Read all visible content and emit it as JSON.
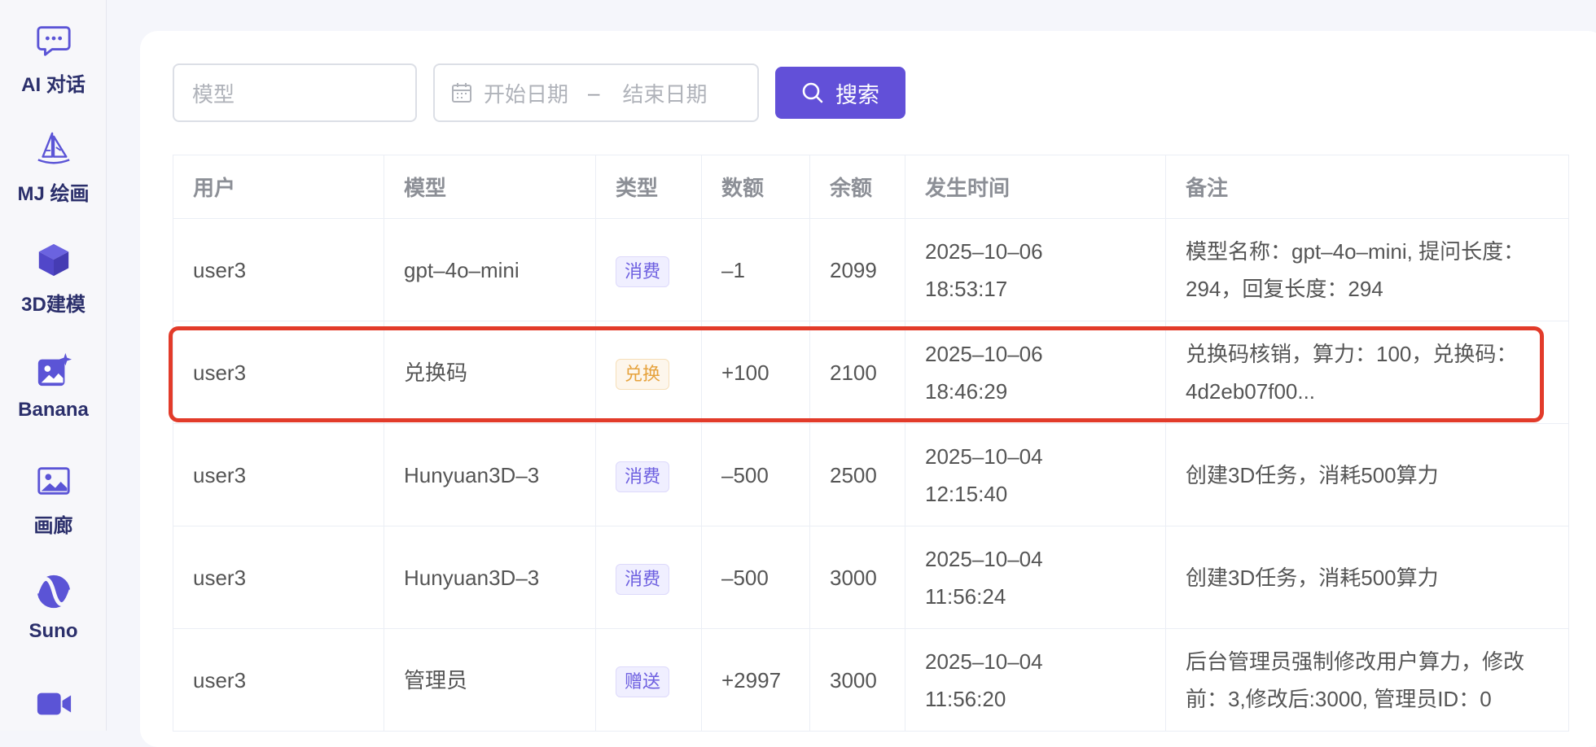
{
  "sidebar": {
    "items": [
      {
        "label": "AI 对话",
        "icon": "chat-icon"
      },
      {
        "label": "MJ 绘画",
        "icon": "sailboat-icon"
      },
      {
        "label": "3D建模",
        "icon": "cube-icon"
      },
      {
        "label": "Banana",
        "icon": "image-sparkle-icon"
      },
      {
        "label": "画廊",
        "icon": "gallery-icon"
      },
      {
        "label": "Suno",
        "icon": "wave-icon"
      },
      {
        "label": "",
        "icon": "video-icon"
      }
    ]
  },
  "search": {
    "model_placeholder": "模型",
    "start_date_placeholder": "开始日期",
    "range_separator": "–",
    "end_date_placeholder": "结束日期",
    "search_label": "搜索"
  },
  "table": {
    "columns": [
      "用户",
      "模型",
      "类型",
      "数额",
      "余额",
      "发生时间",
      "备注"
    ],
    "rows": [
      {
        "user": "user3",
        "model": "gpt–4o–mini",
        "type": "消费",
        "type_style": "spend",
        "amount": "–1",
        "amount_sign": "neg",
        "balance": "2099",
        "date": "2025–10–06",
        "time": "18:53:17",
        "note": "模型名称：gpt–4o–mini, 提问长度：294，回复长度：294"
      },
      {
        "user": "user3",
        "model": "兑换码",
        "type": "兑换",
        "type_style": "redeem",
        "amount": "+100",
        "amount_sign": "pos",
        "balance": "2100",
        "date": "2025–10–06",
        "time": "18:46:29",
        "note": "兑换码核销，算力：100，兑换码：4d2eb07f00..."
      },
      {
        "user": "user3",
        "model": "Hunyuan3D–3",
        "type": "消费",
        "type_style": "spend",
        "amount": "–500",
        "amount_sign": "neg",
        "balance": "2500",
        "date": "2025–10–04",
        "time": "12:15:40",
        "note": "创建3D任务，消耗500算力"
      },
      {
        "user": "user3",
        "model": "Hunyuan3D–3",
        "type": "消费",
        "type_style": "spend",
        "amount": "–500",
        "amount_sign": "neg",
        "balance": "3000",
        "date": "2025–10–04",
        "time": "11:56:24",
        "note": "创建3D任务，消耗500算力"
      },
      {
        "user": "user3",
        "model": "管理员",
        "type": "赠送",
        "type_style": "gift",
        "amount": "+2997",
        "amount_sign": "pos",
        "balance": "3000",
        "date": "2025–10–04",
        "time": "11:56:20",
        "note": "后台管理员强制修改用户算力，修改前：3,修改后:3000, 管理员ID：0"
      }
    ]
  },
  "colors": {
    "accent": "#6250d8",
    "highlight_box": "#e23b2a",
    "negative": "#ec5a5a",
    "positive": "#3bb36c"
  }
}
